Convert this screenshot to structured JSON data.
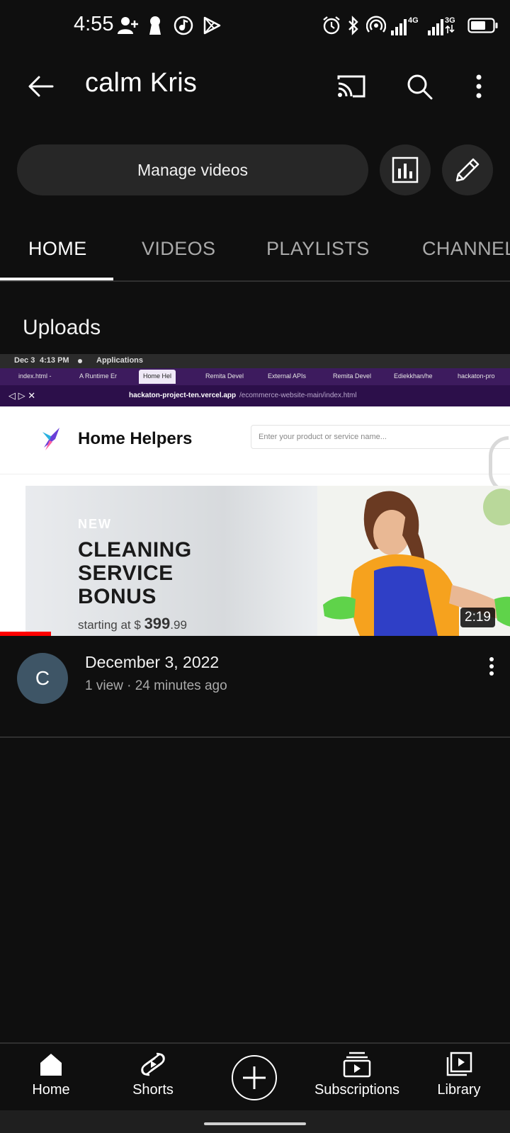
{
  "status_bar": {
    "time": "4:55",
    "icons": [
      "person-add-icon",
      "keyhole-icon",
      "music-note-icon",
      "play-store-icon",
      "alarm-icon",
      "bluetooth-icon",
      "hotspot-icon",
      "signal-4g-icon",
      "signal-3g-icon",
      "battery-icon"
    ],
    "network_1": "4G",
    "network_2": "3G"
  },
  "header": {
    "title": "calm Kris",
    "actions": [
      "cast-icon",
      "search-icon",
      "more-vert-icon"
    ]
  },
  "manage": {
    "label": "Manage videos",
    "analytics_icon": "analytics-icon",
    "edit_icon": "edit-pencil-icon"
  },
  "tabs": [
    {
      "label": "HOME",
      "active": true
    },
    {
      "label": "VIDEOS",
      "active": false
    },
    {
      "label": "PLAYLISTS",
      "active": false
    },
    {
      "label": "CHANNEL",
      "active": false
    }
  ],
  "section_title": "Uploads",
  "thumbnail": {
    "os_date": "Dec 3",
    "os_time": "4:13 PM",
    "os_app": "Applications",
    "browser_tabs": [
      "index.html -",
      "A Runtime Er",
      "Home Hel",
      "Remita Devel",
      "External APIs",
      "Remita Devel",
      "Ediekkhan/he",
      "hackaton-pro"
    ],
    "url_host": "hackaton-project-ten.vercel.app",
    "url_path": "/ecommerce-website-main/index.html",
    "site_name": "Home Helpers",
    "search_placeholder": "Enter your product or service name...",
    "banner_new": "NEW",
    "banner_headline_1": "CLEANING",
    "banner_headline_2": "SERVICE",
    "banner_headline_3": "BONUS",
    "banner_price_prefix": "starting at $",
    "banner_price": "399",
    "banner_cents": ".99",
    "duration": "2:19",
    "watch_progress": 0.1
  },
  "video": {
    "avatar_letter": "C",
    "title": "December 3, 2022",
    "subtitle": "1 view · 24 minutes ago"
  },
  "bottom_nav": [
    {
      "label": "Home",
      "icon": "home-icon"
    },
    {
      "label": "Shorts",
      "icon": "shorts-icon"
    },
    {
      "label": "",
      "icon": "create-plus-icon"
    },
    {
      "label": "Subscriptions",
      "icon": "subscriptions-icon"
    },
    {
      "label": "Library",
      "icon": "library-icon"
    }
  ],
  "colors": {
    "background": "#0f0f0f",
    "surface": "#272727",
    "progress": "#ff0000",
    "muted_text": "#aaaaaa"
  }
}
